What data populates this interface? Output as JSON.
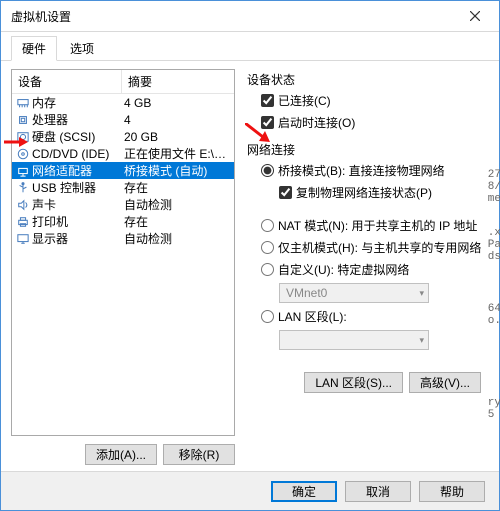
{
  "window": {
    "title": "虚拟机设置"
  },
  "tabs": [
    {
      "label": "硬件",
      "active": true
    },
    {
      "label": "选项",
      "active": false
    }
  ],
  "device_list": {
    "header_device": "设备",
    "header_summary": "摘要",
    "rows": [
      {
        "icon": "memory-icon",
        "name": "内存",
        "summary": "4 GB",
        "selected": false
      },
      {
        "icon": "cpu-icon",
        "name": "处理器",
        "summary": "4",
        "selected": false
      },
      {
        "icon": "disk-icon",
        "name": "硬盘 (SCSI)",
        "summary": "20 GB",
        "selected": false
      },
      {
        "icon": "cd-icon",
        "name": "CD/DVD (IDE)",
        "summary": "正在使用文件 E:\\总下载目录...",
        "selected": false
      },
      {
        "icon": "net-icon",
        "name": "网络适配器",
        "summary": "桥接模式 (自动)",
        "selected": true
      },
      {
        "icon": "usb-icon",
        "name": "USB 控制器",
        "summary": "存在",
        "selected": false
      },
      {
        "icon": "sound-icon",
        "name": "声卡",
        "summary": "自动检测",
        "selected": false
      },
      {
        "icon": "printer-icon",
        "name": "打印机",
        "summary": "存在",
        "selected": false
      },
      {
        "icon": "display-icon",
        "name": "显示器",
        "summary": "自动检测",
        "selected": false
      }
    ]
  },
  "left_buttons": {
    "add": "添加(A)...",
    "remove": "移除(R)"
  },
  "device_state": {
    "title": "设备状态",
    "connected": "已连接(C)",
    "connect_at_poweron": "启动时连接(O)"
  },
  "network_connection": {
    "title": "网络连接",
    "bridged": "桥接模式(B): 直接连接物理网络",
    "replicate": "复制物理网络连接状态(P)",
    "nat": "NAT 模式(N): 用于共享主机的 IP 地址",
    "hostonly": "仅主机模式(H): 与主机共享的专用网络",
    "custom": "自定义(U): 特定虚拟网络",
    "vmnet_value": "VMnet0",
    "lan_segment_radio": "LAN 区段(L):",
    "lan_segment_value": ""
  },
  "right_buttons": {
    "lan_segments": "LAN 区段(S)...",
    "advanced": "高级(V)..."
  },
  "footer": {
    "ok": "确定",
    "cancel": "取消",
    "help": "帮助"
  },
  "side_text": {
    "a": "27",
    "b": "8/",
    "c": "me",
    "d": ".x",
    "e": "Pa",
    "f": "ds",
    "g": "64",
    "h": "o.",
    "i": "ry",
    "j": "5"
  }
}
